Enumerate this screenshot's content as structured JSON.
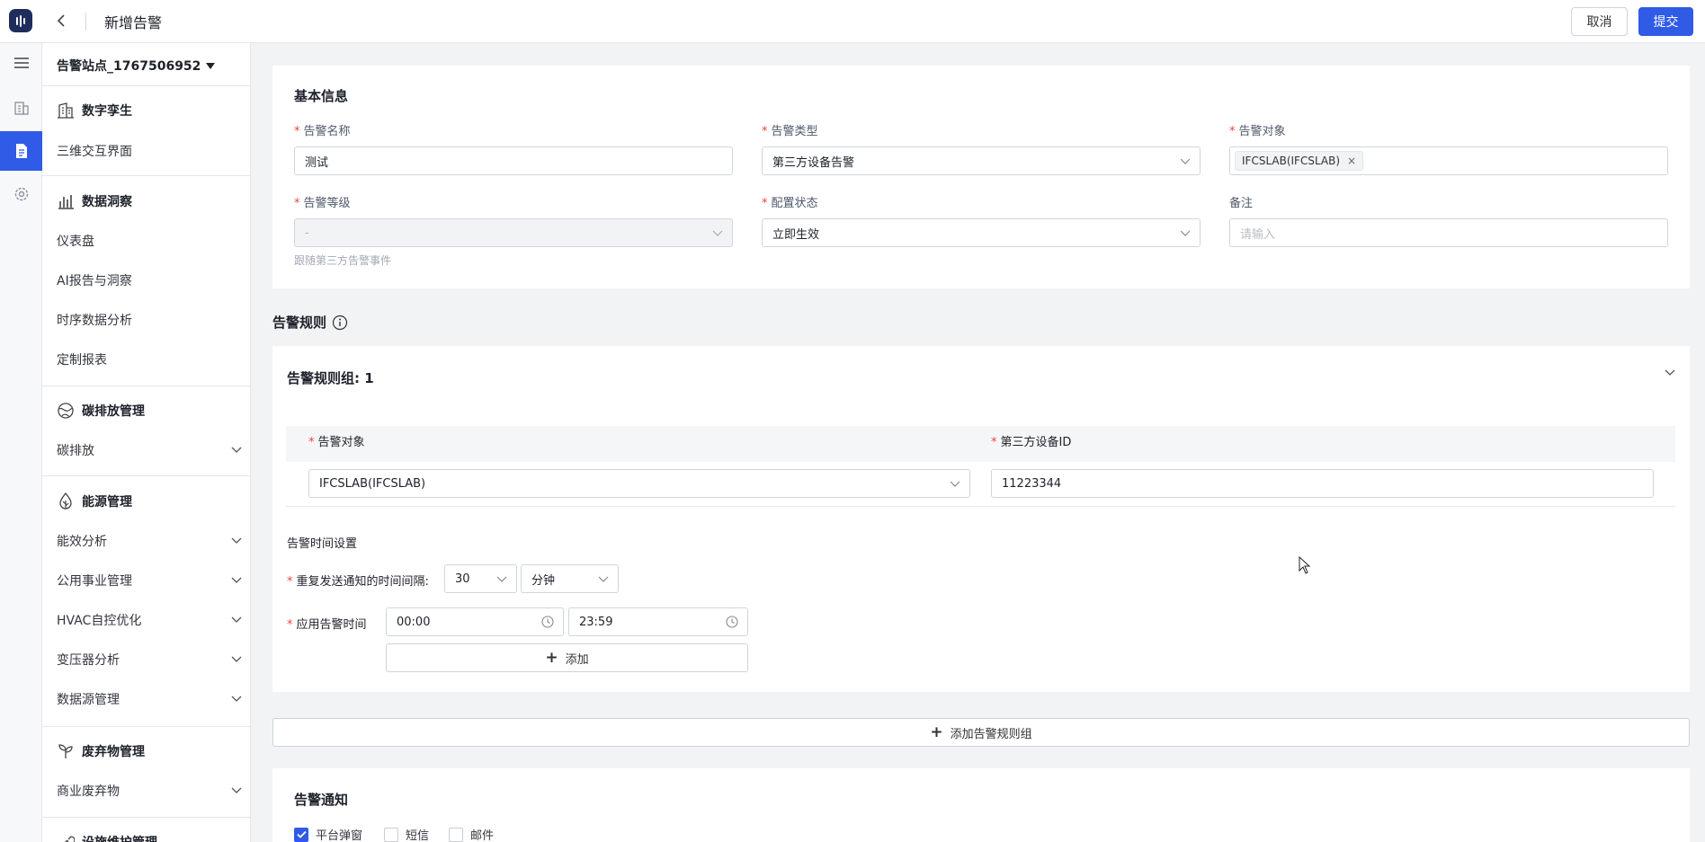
{
  "header": {
    "title": "新增告警",
    "cancel_label": "取消",
    "submit_label": "提交"
  },
  "rail": {
    "items": [
      "building-icon",
      "report-icon",
      "settings-icon"
    ],
    "active_index": 1,
    "accent": "#2f5be6"
  },
  "sidebar": {
    "site": "告警站点_1767506952",
    "groups": [
      {
        "title": "数字孪生",
        "icon": "building-icon",
        "items": [
          {
            "label": "三维交互界面",
            "expandable": false
          }
        ]
      },
      {
        "title": "数据洞察",
        "icon": "bar-chart-icon",
        "items": [
          {
            "label": "仪表盘",
            "expandable": false
          },
          {
            "label": "AI报告与洞察",
            "expandable": false
          },
          {
            "label": "时序数据分析",
            "expandable": false
          },
          {
            "label": "定制报表",
            "expandable": false
          }
        ]
      },
      {
        "title": "碳排放管理",
        "icon": "globe-icon",
        "items": [
          {
            "label": "碳排放",
            "expandable": true
          }
        ]
      },
      {
        "title": "能源管理",
        "icon": "leaf-icon",
        "items": [
          {
            "label": "能效分析",
            "expandable": true
          },
          {
            "label": "公用事业管理",
            "expandable": true
          },
          {
            "label": "HVAC自控优化",
            "expandable": true
          },
          {
            "label": "变压器分析",
            "expandable": true
          },
          {
            "label": "数据源管理",
            "expandable": true
          }
        ]
      },
      {
        "title": "废弃物管理",
        "icon": "sprout-icon",
        "items": [
          {
            "label": "商业废弃物",
            "expandable": true
          }
        ]
      },
      {
        "title": "设施维护管理",
        "icon": "tools-icon",
        "items": []
      }
    ]
  },
  "basic": {
    "title": "基本信息",
    "name_label": "告警名称",
    "name_value": "测试",
    "type_label": "告警类型",
    "type_value": "第三方设备告警",
    "object_label": "告警对象",
    "object_tag": "IFCSLAB(IFCSLAB)",
    "level_label": "告警等级",
    "level_value": "-",
    "level_hint": "跟随第三方告警事件",
    "status_label": "配置状态",
    "status_value": "立即生效",
    "remark_label": "备注",
    "remark_placeholder": "请输入"
  },
  "rules": {
    "title": "告警规则",
    "group_title": "告警规则组: 1",
    "col_object": "告警对象",
    "col_device": "第三方设备ID",
    "object_value": "IFCSLAB(IFCSLAB)",
    "device_value": "11223344",
    "time_settings_title": "告警时间设置",
    "interval_label": "重复发送通知的时间间隔:",
    "interval_value": "30",
    "interval_unit": "分钟",
    "apply_time_label": "应用告警时间",
    "start_time": "00:00",
    "end_time": "23:59",
    "add_label": "添加",
    "add_group_label": "添加告警规则组"
  },
  "notify": {
    "title": "告警通知",
    "options": [
      {
        "label": "平台弹窗",
        "checked": true
      },
      {
        "label": "短信",
        "checked": false
      },
      {
        "label": "邮件",
        "checked": false
      }
    ]
  }
}
